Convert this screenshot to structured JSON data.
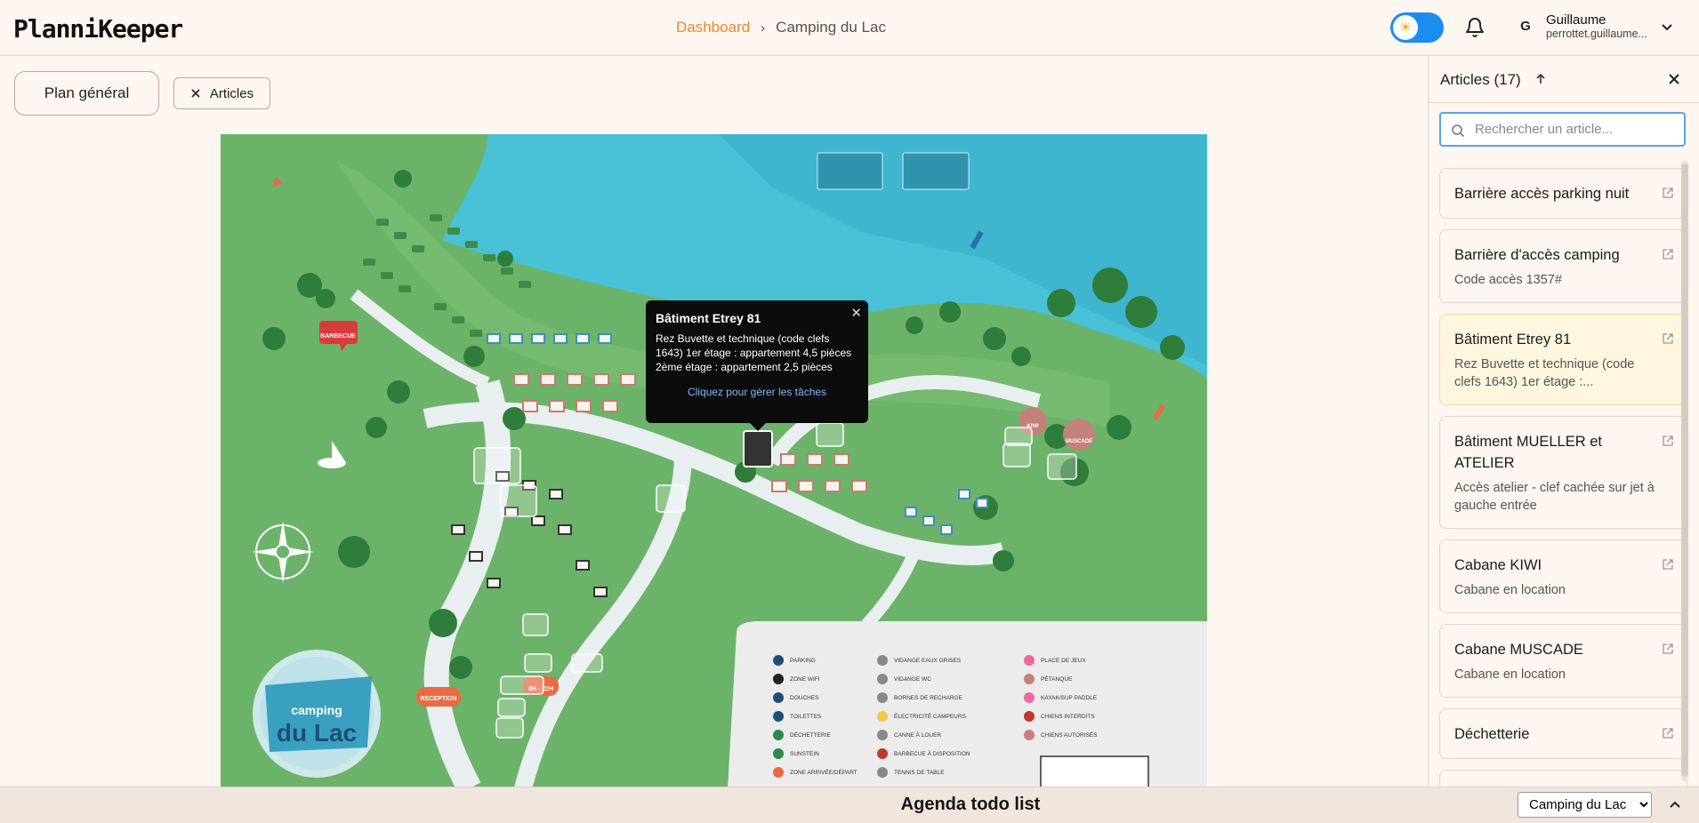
{
  "app": {
    "logo": "PlanniKeeper"
  },
  "breadcrumb": {
    "dashboard": "Dashboard",
    "current": "Camping du Lac"
  },
  "user": {
    "initial": "G",
    "name": "Guillaume",
    "email": "perrottet.guillaume..."
  },
  "toolbar": {
    "plan_label": "Plan général",
    "articles_label": "Articles"
  },
  "map": {
    "labels": {
      "barbecue": "BARBECUE",
      "reception": "RECEPTION",
      "hours": "8H - 22H",
      "muscade": "MUSCADE",
      "kiwi": "KIWI",
      "logo_line1": "camping",
      "logo_line2": "du Lac"
    },
    "legend": {
      "col1": [
        "PARKING",
        "ZONE WIFI",
        "DOUCHES",
        "TOILETTES",
        "DÉCHETTERIE",
        "SUNSTEIN",
        "ZONE ARRIVÉE/DÉPART"
      ],
      "col2": [
        "VIDANGE EAUX GRISES",
        "VIDANGE WC",
        "BORNES DE RECHARGE",
        "ÉLECTRICITÉ CAMPEURS",
        "CANNE À LOUER",
        "BARBECUE À DISPOSITION",
        "TENNIS DE TABLE"
      ],
      "col3": [
        "PLACE DE JEUX",
        "PÉTANQUE",
        "KAYAK/SUP PADDLE",
        "CHIENS INTERDITS",
        "CHIENS AUTORISÉS"
      ]
    }
  },
  "popup": {
    "title": "Bâtiment Etrey 81",
    "description": "Rez Buvette et technique (code clefs 1643) 1er étage : appartement 4,5 pièces 2ème étage : appartement 2,5 pièces",
    "link": "Cliquez pour gérer les tâches"
  },
  "panel": {
    "title": "Articles (17)",
    "search_placeholder": "Rechercher un article...",
    "items": [
      {
        "title": "Barrière accès parking nuit",
        "subtitle": ""
      },
      {
        "title": "Barrière d'accès camping",
        "subtitle": "Code accès 1357#"
      },
      {
        "title": "Bâtiment Etrey 81",
        "subtitle": "Rez Buvette et technique (code clefs 1643) 1er étage :..."
      },
      {
        "title": "Bâtiment MUELLER et ATELIER",
        "subtitle": "Accès atelier - clef cachée sur jet à gauche entrée"
      },
      {
        "title": "Cabane KIWI",
        "subtitle": "Cabane en location"
      },
      {
        "title": "Cabane MUSCADE",
        "subtitle": "Cabane en location"
      },
      {
        "title": "Déchetterie",
        "subtitle": ""
      }
    ]
  },
  "bottom": {
    "title": "Agenda todo list",
    "selected_site": "Camping du Lac"
  },
  "colors": {
    "accent": "#e98a2c",
    "toggle": "#1b8df0",
    "water": "#4fc4d9",
    "land": "#6cb36a",
    "selected_card": "#fff6e0"
  },
  "icons": [
    "sun-icon",
    "bell-icon",
    "chevron-down-icon",
    "close-icon",
    "arrow-up-icon",
    "search-icon",
    "external-link-icon",
    "chevron-up-icon"
  ]
}
